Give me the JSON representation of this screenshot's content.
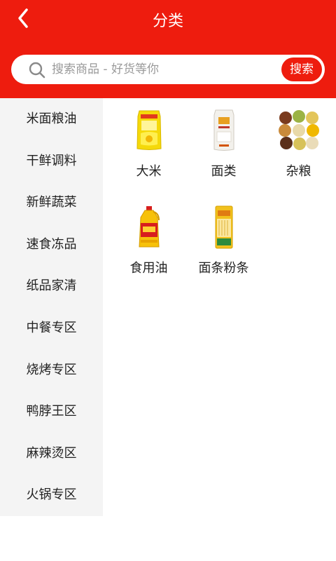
{
  "header": {
    "title": "分类"
  },
  "search": {
    "placeholder": "搜索商品 - 好货等你",
    "button_label": "搜索"
  },
  "sidebar": {
    "items": [
      {
        "label": "米面粮油"
      },
      {
        "label": "干鲜调料"
      },
      {
        "label": "新鲜蔬菜"
      },
      {
        "label": "速食冻品"
      },
      {
        "label": "纸品家清"
      },
      {
        "label": "中餐专区"
      },
      {
        "label": "烧烤专区"
      },
      {
        "label": "鸭脖王区"
      },
      {
        "label": "麻辣烫区"
      },
      {
        "label": "火锅专区"
      }
    ]
  },
  "categories": [
    {
      "label": "大米",
      "icon": "rice-bag-icon"
    },
    {
      "label": "面类",
      "icon": "flour-bag-icon"
    },
    {
      "label": "杂粮",
      "icon": "grains-bowls-icon"
    },
    {
      "label": "食用油",
      "icon": "oil-bottle-icon"
    },
    {
      "label": "面条粉条",
      "icon": "noodle-pack-icon"
    }
  ],
  "colors": {
    "brand_red": "#ee1c0e",
    "sidebar_bg": "#f4f4f4"
  }
}
